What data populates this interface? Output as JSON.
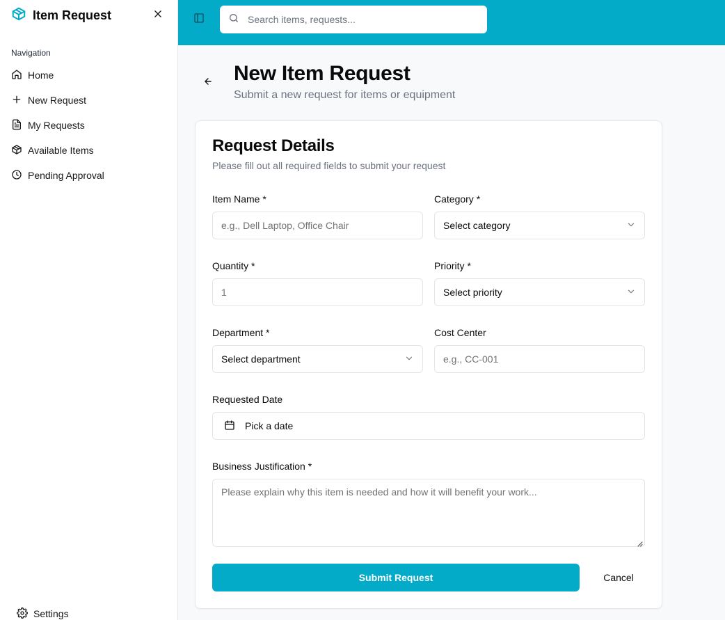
{
  "sidebar": {
    "brand_title": "Item Request",
    "brand_icon": "package-icon",
    "brand_color": "#04abc8",
    "nav_label": "Navigation",
    "items": [
      {
        "label": "Home",
        "icon": "home-icon"
      },
      {
        "label": "New Request",
        "icon": "plus-icon"
      },
      {
        "label": "My Requests",
        "icon": "file-text-icon"
      },
      {
        "label": "Available Items",
        "icon": "package-icon"
      },
      {
        "label": "Pending Approval",
        "icon": "clock-icon"
      }
    ],
    "settings_label": "Settings"
  },
  "topbar": {
    "color": "#04abc8",
    "search_placeholder": "Search items, requests..."
  },
  "page": {
    "title": "New Item Request",
    "subtitle": "Submit a new request for items or equipment"
  },
  "form": {
    "title": "Request Details",
    "description": "Please fill out all required fields to submit your request",
    "item_name": {
      "label": "Item Name *",
      "placeholder": "e.g., Dell Laptop, Office Chair",
      "value": ""
    },
    "category": {
      "label": "Category *",
      "value": "Select category"
    },
    "quantity": {
      "label": "Quantity *",
      "placeholder": "1",
      "value": ""
    },
    "priority": {
      "label": "Priority *",
      "value": "Select priority"
    },
    "department": {
      "label": "Department *",
      "value": "Select department"
    },
    "cost_center": {
      "label": "Cost Center",
      "placeholder": "e.g., CC-001",
      "value": ""
    },
    "requested_date": {
      "label": "Requested Date",
      "value": "Pick a date"
    },
    "justification": {
      "label": "Business Justification *",
      "placeholder": "Please explain why this item is needed and how it will benefit your work...",
      "value": ""
    },
    "submit_label": "Submit Request",
    "cancel_label": "Cancel"
  }
}
